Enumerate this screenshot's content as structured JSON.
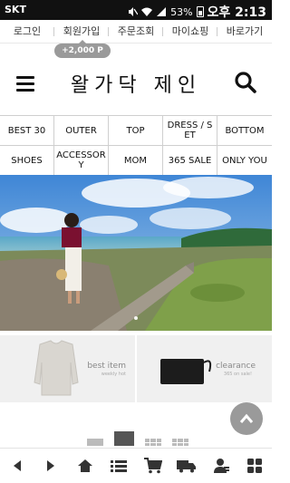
{
  "status_bar": {
    "carrier": "SKT",
    "battery": "53%",
    "time": "오후 2:13",
    "icons": [
      "mute-icon",
      "wifi-icon",
      "signal-icon",
      "battery-icon"
    ]
  },
  "top_links": [
    "로그인",
    "회원가입",
    "주문조회",
    "마이쇼핑",
    "바로가기"
  ],
  "points_badge": "+2,000 P",
  "header": {
    "logo": "왈가닥 제인",
    "icons": [
      "hamburger-menu-icon",
      "search-icon"
    ]
  },
  "categories": [
    "BEST 30",
    "OUTER",
    "TOP",
    "DRESS / SET",
    "BOTTOM",
    "SHOES",
    "ACCESSORY",
    "MOM",
    "365 SALE",
    "ONLY YOU"
  ],
  "banners": [
    {
      "title": "best item",
      "subtitle": "weekly hot"
    },
    {
      "title": "clearance",
      "subtitle": "365 on sale!"
    }
  ],
  "bottom_nav": [
    "back-icon",
    "forward-icon",
    "home-icon",
    "list-icon",
    "cart-icon",
    "delivery-truck-icon",
    "my-account-icon",
    "grid-menu-icon"
  ],
  "colors": {
    "accent": "#111111",
    "badge": "#9a9a9a",
    "status_bar": "#111111"
  }
}
